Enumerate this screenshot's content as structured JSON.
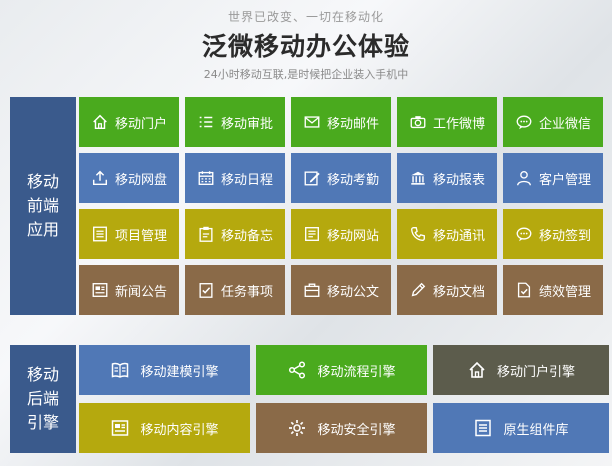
{
  "header": {
    "tagline": "世界已改变、一切在移动化",
    "title": "泛微移动办公体验",
    "subtitle": "24小时移动互联,是时候把企业装入手机中"
  },
  "front": {
    "label_lines": [
      "移动",
      "前端",
      "应用"
    ],
    "tiles": [
      {
        "label": "移动门户",
        "icon": "home-icon",
        "color": "#4aaa1e"
      },
      {
        "label": "移动审批",
        "icon": "checklist-icon",
        "color": "#4aaa1e"
      },
      {
        "label": "移动邮件",
        "icon": "mail-icon",
        "color": "#4aaa1e"
      },
      {
        "label": "工作微博",
        "icon": "camera-icon",
        "color": "#4aaa1e"
      },
      {
        "label": "企业微信",
        "icon": "chat-icon",
        "color": "#4aaa1e"
      },
      {
        "label": "移动网盘",
        "icon": "upload-icon",
        "color": "#5078b6"
      },
      {
        "label": "移动日程",
        "icon": "calendar-icon",
        "color": "#5078b6"
      },
      {
        "label": "移动考勤",
        "icon": "edit-icon",
        "color": "#5078b6"
      },
      {
        "label": "移动报表",
        "icon": "bank-icon",
        "color": "#5078b6"
      },
      {
        "label": "客户管理",
        "icon": "user-icon",
        "color": "#5078b6"
      },
      {
        "label": "项目管理",
        "icon": "list-icon",
        "color": "#b5a90e"
      },
      {
        "label": "移动备忘",
        "icon": "clipboard-icon",
        "color": "#b5a90e"
      },
      {
        "label": "移动网站",
        "icon": "note-icon",
        "color": "#b5a90e"
      },
      {
        "label": "移动通讯",
        "icon": "phone-icon",
        "color": "#b5a90e"
      },
      {
        "label": "移动签到",
        "icon": "chat-dots-icon",
        "color": "#b5a90e"
      },
      {
        "label": "新闻公告",
        "icon": "news-icon",
        "color": "#8a6a48"
      },
      {
        "label": "任务事项",
        "icon": "task-icon",
        "color": "#8a6a48"
      },
      {
        "label": "移动公文",
        "icon": "briefcase-icon",
        "color": "#8a6a48"
      },
      {
        "label": "移动文档",
        "icon": "pencil-icon",
        "color": "#8a6a48"
      },
      {
        "label": "绩效管理",
        "icon": "file-check-icon",
        "color": "#8a6a48"
      }
    ]
  },
  "back": {
    "label_lines": [
      "移动",
      "后端",
      "引擎"
    ],
    "tiles": [
      {
        "label": "移动建模引擎",
        "icon": "book-icon",
        "color": "#5078b6"
      },
      {
        "label": "移动流程引擎",
        "icon": "share-icon",
        "color": "#4aaa1e"
      },
      {
        "label": "移动门户引擎",
        "icon": "home-icon",
        "color": "#5c5c4c"
      },
      {
        "label": "移动内容引擎",
        "icon": "news-icon",
        "color": "#b5a90e"
      },
      {
        "label": "移动安全引擎",
        "icon": "gear-icon",
        "color": "#8a6a48"
      },
      {
        "label": "原生组件库",
        "icon": "list-icon",
        "color": "#5078b6"
      }
    ]
  }
}
